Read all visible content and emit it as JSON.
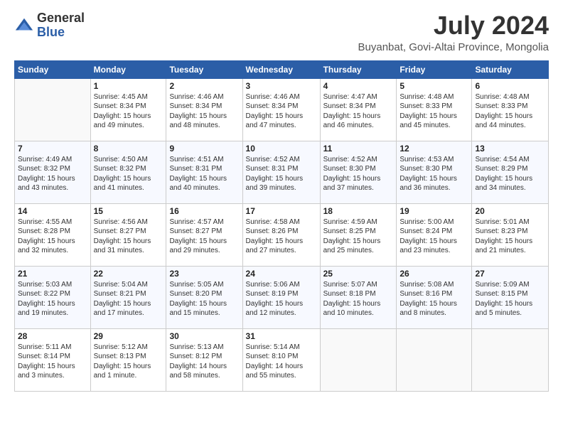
{
  "header": {
    "logo_general": "General",
    "logo_blue": "Blue",
    "month_title": "July 2024",
    "subtitle": "Buyanbat, Govi-Altai Province, Mongolia"
  },
  "weekdays": [
    "Sunday",
    "Monday",
    "Tuesday",
    "Wednesday",
    "Thursday",
    "Friday",
    "Saturday"
  ],
  "weeks": [
    [
      {
        "day": "",
        "sunrise": "",
        "sunset": "",
        "daylight": ""
      },
      {
        "day": "1",
        "sunrise": "Sunrise: 4:45 AM",
        "sunset": "Sunset: 8:34 PM",
        "daylight": "Daylight: 15 hours and 49 minutes."
      },
      {
        "day": "2",
        "sunrise": "Sunrise: 4:46 AM",
        "sunset": "Sunset: 8:34 PM",
        "daylight": "Daylight: 15 hours and 48 minutes."
      },
      {
        "day": "3",
        "sunrise": "Sunrise: 4:46 AM",
        "sunset": "Sunset: 8:34 PM",
        "daylight": "Daylight: 15 hours and 47 minutes."
      },
      {
        "day": "4",
        "sunrise": "Sunrise: 4:47 AM",
        "sunset": "Sunset: 8:34 PM",
        "daylight": "Daylight: 15 hours and 46 minutes."
      },
      {
        "day": "5",
        "sunrise": "Sunrise: 4:48 AM",
        "sunset": "Sunset: 8:33 PM",
        "daylight": "Daylight: 15 hours and 45 minutes."
      },
      {
        "day": "6",
        "sunrise": "Sunrise: 4:48 AM",
        "sunset": "Sunset: 8:33 PM",
        "daylight": "Daylight: 15 hours and 44 minutes."
      }
    ],
    [
      {
        "day": "7",
        "sunrise": "Sunrise: 4:49 AM",
        "sunset": "Sunset: 8:32 PM",
        "daylight": "Daylight: 15 hours and 43 minutes."
      },
      {
        "day": "8",
        "sunrise": "Sunrise: 4:50 AM",
        "sunset": "Sunset: 8:32 PM",
        "daylight": "Daylight: 15 hours and 41 minutes."
      },
      {
        "day": "9",
        "sunrise": "Sunrise: 4:51 AM",
        "sunset": "Sunset: 8:31 PM",
        "daylight": "Daylight: 15 hours and 40 minutes."
      },
      {
        "day": "10",
        "sunrise": "Sunrise: 4:52 AM",
        "sunset": "Sunset: 8:31 PM",
        "daylight": "Daylight: 15 hours and 39 minutes."
      },
      {
        "day": "11",
        "sunrise": "Sunrise: 4:52 AM",
        "sunset": "Sunset: 8:30 PM",
        "daylight": "Daylight: 15 hours and 37 minutes."
      },
      {
        "day": "12",
        "sunrise": "Sunrise: 4:53 AM",
        "sunset": "Sunset: 8:30 PM",
        "daylight": "Daylight: 15 hours and 36 minutes."
      },
      {
        "day": "13",
        "sunrise": "Sunrise: 4:54 AM",
        "sunset": "Sunset: 8:29 PM",
        "daylight": "Daylight: 15 hours and 34 minutes."
      }
    ],
    [
      {
        "day": "14",
        "sunrise": "Sunrise: 4:55 AM",
        "sunset": "Sunset: 8:28 PM",
        "daylight": "Daylight: 15 hours and 32 minutes."
      },
      {
        "day": "15",
        "sunrise": "Sunrise: 4:56 AM",
        "sunset": "Sunset: 8:27 PM",
        "daylight": "Daylight: 15 hours and 31 minutes."
      },
      {
        "day": "16",
        "sunrise": "Sunrise: 4:57 AM",
        "sunset": "Sunset: 8:27 PM",
        "daylight": "Daylight: 15 hours and 29 minutes."
      },
      {
        "day": "17",
        "sunrise": "Sunrise: 4:58 AM",
        "sunset": "Sunset: 8:26 PM",
        "daylight": "Daylight: 15 hours and 27 minutes."
      },
      {
        "day": "18",
        "sunrise": "Sunrise: 4:59 AM",
        "sunset": "Sunset: 8:25 PM",
        "daylight": "Daylight: 15 hours and 25 minutes."
      },
      {
        "day": "19",
        "sunrise": "Sunrise: 5:00 AM",
        "sunset": "Sunset: 8:24 PM",
        "daylight": "Daylight: 15 hours and 23 minutes."
      },
      {
        "day": "20",
        "sunrise": "Sunrise: 5:01 AM",
        "sunset": "Sunset: 8:23 PM",
        "daylight": "Daylight: 15 hours and 21 minutes."
      }
    ],
    [
      {
        "day": "21",
        "sunrise": "Sunrise: 5:03 AM",
        "sunset": "Sunset: 8:22 PM",
        "daylight": "Daylight: 15 hours and 19 minutes."
      },
      {
        "day": "22",
        "sunrise": "Sunrise: 5:04 AM",
        "sunset": "Sunset: 8:21 PM",
        "daylight": "Daylight: 15 hours and 17 minutes."
      },
      {
        "day": "23",
        "sunrise": "Sunrise: 5:05 AM",
        "sunset": "Sunset: 8:20 PM",
        "daylight": "Daylight: 15 hours and 15 minutes."
      },
      {
        "day": "24",
        "sunrise": "Sunrise: 5:06 AM",
        "sunset": "Sunset: 8:19 PM",
        "daylight": "Daylight: 15 hours and 12 minutes."
      },
      {
        "day": "25",
        "sunrise": "Sunrise: 5:07 AM",
        "sunset": "Sunset: 8:18 PM",
        "daylight": "Daylight: 15 hours and 10 minutes."
      },
      {
        "day": "26",
        "sunrise": "Sunrise: 5:08 AM",
        "sunset": "Sunset: 8:16 PM",
        "daylight": "Daylight: 15 hours and 8 minutes."
      },
      {
        "day": "27",
        "sunrise": "Sunrise: 5:09 AM",
        "sunset": "Sunset: 8:15 PM",
        "daylight": "Daylight: 15 hours and 5 minutes."
      }
    ],
    [
      {
        "day": "28",
        "sunrise": "Sunrise: 5:11 AM",
        "sunset": "Sunset: 8:14 PM",
        "daylight": "Daylight: 15 hours and 3 minutes."
      },
      {
        "day": "29",
        "sunrise": "Sunrise: 5:12 AM",
        "sunset": "Sunset: 8:13 PM",
        "daylight": "Daylight: 15 hours and 1 minute."
      },
      {
        "day": "30",
        "sunrise": "Sunrise: 5:13 AM",
        "sunset": "Sunset: 8:12 PM",
        "daylight": "Daylight: 14 hours and 58 minutes."
      },
      {
        "day": "31",
        "sunrise": "Sunrise: 5:14 AM",
        "sunset": "Sunset: 8:10 PM",
        "daylight": "Daylight: 14 hours and 55 minutes."
      },
      {
        "day": "",
        "sunrise": "",
        "sunset": "",
        "daylight": ""
      },
      {
        "day": "",
        "sunrise": "",
        "sunset": "",
        "daylight": ""
      },
      {
        "day": "",
        "sunrise": "",
        "sunset": "",
        "daylight": ""
      }
    ]
  ]
}
